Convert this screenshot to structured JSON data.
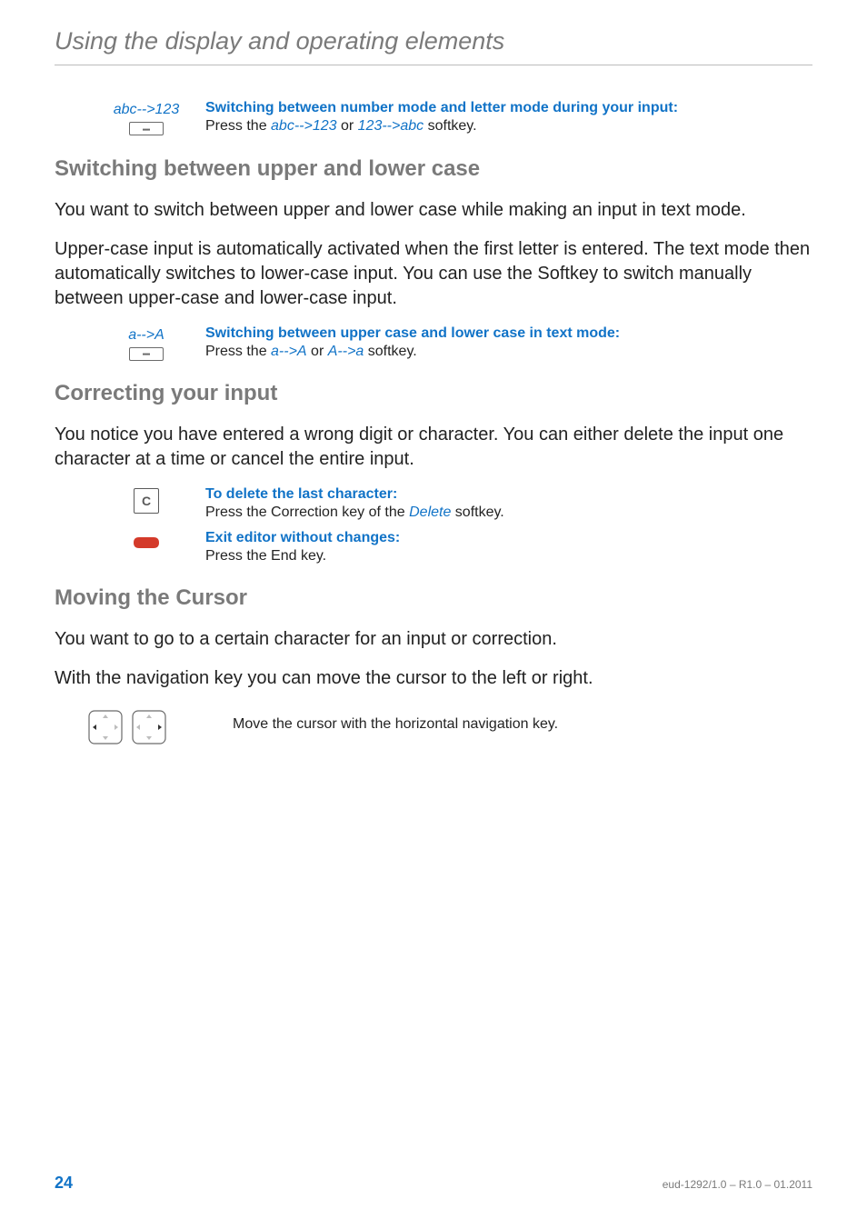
{
  "header": {
    "title": "Using the display and operating elements"
  },
  "block1": {
    "softkey_label": "abc-->123",
    "heading": "Switching between number mode and letter mode during your input:",
    "body_pre": "Press the ",
    "body_link1": "abc-->123",
    "body_mid": " or ",
    "body_link2": "123-->abc",
    "body_post": " softkey."
  },
  "section1": {
    "title": "Switching between upper and lower case",
    "p1": "You want to switch between upper and lower case while making an input in text mode.",
    "p2": "Upper-case input is automatically activated when the first letter is entered. The text mode then automatically switches to lower-case input. You can use the Softkey to switch manually between upper-case and lower-case input.",
    "softkey_label": "a-->A",
    "inst_heading": "Switching between upper case and lower case in text mode:",
    "inst_pre": "Press the ",
    "inst_link1": "a-->A",
    "inst_mid": " or ",
    "inst_link2": "A-->a",
    "inst_post": " softkey."
  },
  "section2": {
    "title": "Correcting your input",
    "p1": "You notice you have entered a wrong digit or character. You can either delete the input one character at a time or cancel the entire input.",
    "row1_heading": "To delete the last character:",
    "row1_pre": "Press the Correction key of the ",
    "row1_link": "Delete",
    "row1_post": " softkey.",
    "row2_heading": "Exit editor without changes:",
    "row2_body": "Press the End key.",
    "c_key": "C"
  },
  "section3": {
    "title": "Moving the Cursor",
    "p1": "You want to go to a certain character for an input or correction.",
    "p2": "With the navigation key you can move the cursor to the left or right.",
    "inst": "Move the cursor with the horizontal navigation key."
  },
  "footer": {
    "page": "24",
    "docid": "eud-1292/1.0 – R1.0 – 01.2011"
  }
}
